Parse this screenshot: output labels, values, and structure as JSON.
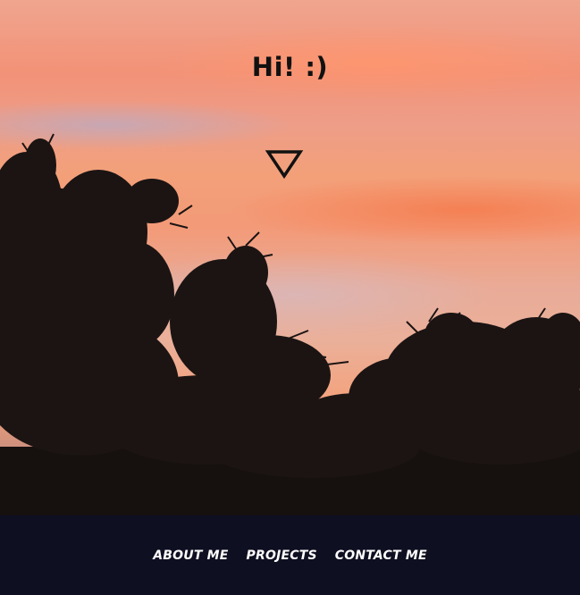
{
  "hero": {
    "greeting": "Hi! :)",
    "scroll_icon": "triangle-down-icon",
    "background": "sunset-sky-with-tree-silhouettes"
  },
  "nav": {
    "items": [
      {
        "label": "ABOUT ME"
      },
      {
        "label": "PROJECTS"
      },
      {
        "label": "CONTACT ME"
      }
    ]
  },
  "colors": {
    "footer_bg": "#0f0f22",
    "nav_text": "#ffffff",
    "title_text": "#111111",
    "sky_orange": "#f29277"
  }
}
